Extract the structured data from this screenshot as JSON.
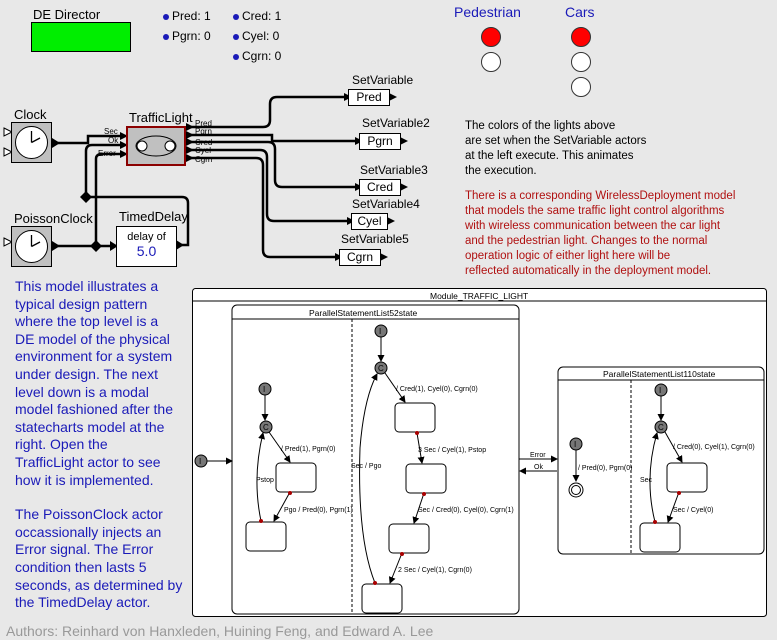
{
  "director": {
    "label": "DE Director",
    "color": "#00ee00"
  },
  "variables": {
    "col1": [
      {
        "name": "Pred",
        "value": "1",
        "text": "Pred: 1"
      },
      {
        "name": "Pgrn",
        "value": "0",
        "text": "Pgrn: 0"
      }
    ],
    "col2": [
      {
        "name": "Cred",
        "value": "1",
        "text": "Cred: 1"
      },
      {
        "name": "Cyel",
        "value": "0",
        "text": "Cyel: 0"
      },
      {
        "name": "Cgrn",
        "value": "0",
        "text": "Cgrn: 0"
      }
    ]
  },
  "lights": {
    "pedestrian": {
      "title": "Pedestrian",
      "states": [
        "red-on",
        "off"
      ]
    },
    "cars": {
      "title": "Cars",
      "states": [
        "red-on",
        "off",
        "off"
      ]
    },
    "on_color": "#ff0000",
    "off_color": "#ffffff"
  },
  "actors": {
    "clock": {
      "label": "Clock",
      "icon": "clock-icon"
    },
    "poisson_clock": {
      "label": "PoissonClock",
      "icon": "clock-icon"
    },
    "traffic_light": {
      "label": "TrafficLight",
      "inputs": [
        "Sec",
        "Ok",
        "Error"
      ],
      "outputs": [
        "Pred",
        "Pgrn",
        "Cred",
        "Cyel",
        "Cgrn"
      ]
    },
    "timed_delay": {
      "label": "TimedDelay",
      "line1": "delay of",
      "value": "5.0"
    },
    "set_variables": [
      {
        "label": "SetVariable",
        "var": "Pred"
      },
      {
        "label": "SetVariable2",
        "var": "Pgrn"
      },
      {
        "label": "SetVariable3",
        "var": "Cred"
      },
      {
        "label": "SetVariable4",
        "var": "Cyel"
      },
      {
        "label": "SetVariable5",
        "var": "Cgrn"
      }
    ]
  },
  "notes": {
    "lights_note": [
      "The colors of the lights above",
      "are set when the SetVariable actors",
      "at the left execute. This animates",
      "the execution."
    ],
    "wireless_note": [
      "There is a corresponding WirelessDeployment model",
      "that models the same traffic light control algorithms",
      "with wireless communication between the car light",
      "and the pedestrian light. Changes to the normal",
      "operation logic of either light here will be",
      "reflected automatically in the deployment model."
    ],
    "model_note": [
      "This model illustrates a",
      "typical design pattern",
      "where the top level is a",
      "DE model of the physical",
      "environment for a system",
      "under design. The next",
      "level down is a modal",
      "model fashioned after the",
      "statecharts model at the",
      "right.  Open the",
      "TrafficLight actor to see",
      "how it is implemented."
    ],
    "poisson_note": [
      "The PoissonClock actor",
      "occassionally injects an",
      "Error signal. The Error",
      "condition then lasts 5",
      "seconds, as determined by",
      "the TimedDelay actor."
    ],
    "authors": "Authors: Reinhard von Hanxleden, Huining Feng, and Edward A. Lee"
  },
  "statechart": {
    "module_title": "Module_TRAFFIC_LIGHT",
    "psl52_title": "ParallelStatementList52state",
    "psl110_title": "ParallelStatementList110state",
    "initial_label": "I",
    "choice_label": "C",
    "transitions": {
      "ped_entry": "/ Pred(1), Pgrn(0)",
      "ped_pstop": "Pstop",
      "ped_pgo": "Pgo / Pred(0), Pgrn(1)",
      "car_entry": "/ Cred(1), Cyel(0), Cgrn(0)",
      "car_3sec": "3 Sec / Cyel(1), Pstop",
      "car_secpgo": "Sec / Pgo",
      "car_sec_green": "Sec / Cred(0), Cyel(0), Cgrn(1)",
      "car_2sec": "2 Sec / Cyel(1), Cgrn(0)",
      "err_ped": "/ Pred(0), Pgrn(0)",
      "err_entry": "/ Cred(0), Cyel(1), Cgrn(0)",
      "err_sec": "Sec",
      "err_sec_cyel": "Sec / Cyel(0)",
      "error": "Error",
      "ok": "Ok"
    }
  }
}
